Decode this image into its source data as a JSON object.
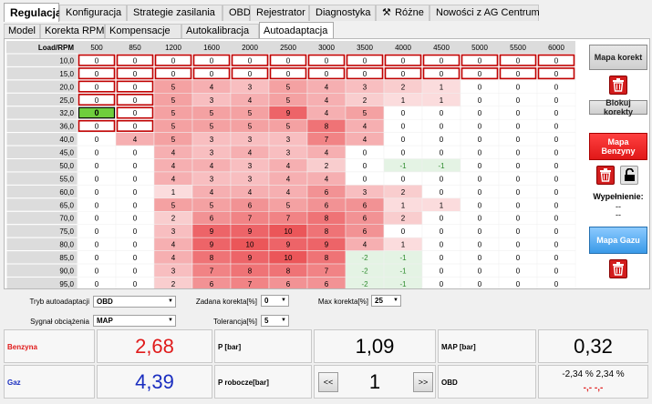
{
  "main_tabs": [
    {
      "label": "Regulacja",
      "active": true
    },
    {
      "label": "Konfiguracja",
      "active": false
    },
    {
      "label": "Strategie zasilania",
      "active": false
    },
    {
      "label": "OBD",
      "active": false
    },
    {
      "label": "Rejestrator",
      "active": false
    },
    {
      "label": "Diagnostyka",
      "active": false
    },
    {
      "label": "Różne",
      "active": false,
      "icon": "tools-icon"
    },
    {
      "label": "Nowości z AG Centrum",
      "active": false
    }
  ],
  "sub_tabs": [
    {
      "label": "Model",
      "active": false
    },
    {
      "label": "Korekta RPM",
      "active": false
    },
    {
      "label": "Kompensacje",
      "active": false
    },
    {
      "label": "Autokalibracja",
      "active": false
    },
    {
      "label": "Autoadaptacja",
      "active": true
    }
  ],
  "grid": {
    "corner_label": "Load/RPM",
    "rpm": [
      "500",
      "850",
      "1200",
      "1600",
      "2000",
      "2500",
      "3000",
      "3500",
      "4000",
      "4500",
      "5000",
      "5500",
      "6000"
    ],
    "loads": [
      "10,0",
      "15,0",
      "20,0",
      "25,0",
      "32,0",
      "36,0",
      "40,0",
      "45,0",
      "50,0",
      "55,0",
      "60,0",
      "65,0",
      "70,0",
      "75,0",
      "80,0",
      "85,0",
      "90,0",
      "95,0"
    ],
    "values": [
      [
        "0",
        "0",
        "0",
        "0",
        "0",
        "0",
        "0",
        "0",
        "0",
        "0",
        "0",
        "0",
        "0"
      ],
      [
        "0",
        "0",
        "0",
        "0",
        "0",
        "0",
        "0",
        "0",
        "0",
        "0",
        "0",
        "0",
        "0"
      ],
      [
        "0",
        "0",
        "5",
        "4",
        "3",
        "5",
        "4",
        "3",
        "2",
        "1",
        "0",
        "0",
        "0"
      ],
      [
        "0",
        "0",
        "5",
        "3",
        "4",
        "5",
        "4",
        "2",
        "1",
        "1",
        "0",
        "0",
        "0"
      ],
      [
        "0",
        "0",
        "5",
        "5",
        "5",
        "9",
        "4",
        "5",
        "0",
        "0",
        "0",
        "0",
        "0"
      ],
      [
        "0",
        "0",
        "5",
        "5",
        "5",
        "5",
        "8",
        "4",
        "0",
        "0",
        "0",
        "0",
        "0"
      ],
      [
        "0",
        "4",
        "5",
        "3",
        "3",
        "3",
        "7",
        "4",
        "0",
        "0",
        "0",
        "0",
        "0"
      ],
      [
        "0",
        "0",
        "4",
        "3",
        "4",
        "3",
        "4",
        "0",
        "0",
        "0",
        "0",
        "0",
        "0"
      ],
      [
        "0",
        "0",
        "4",
        "4",
        "3",
        "4",
        "2",
        "0",
        "-1",
        "-1",
        "0",
        "0",
        "0"
      ],
      [
        "0",
        "0",
        "4",
        "3",
        "3",
        "4",
        "4",
        "0",
        "0",
        "0",
        "0",
        "0",
        "0"
      ],
      [
        "0",
        "0",
        "1",
        "4",
        "4",
        "4",
        "6",
        "3",
        "2",
        "0",
        "0",
        "0",
        "0"
      ],
      [
        "0",
        "0",
        "5",
        "5",
        "6",
        "5",
        "6",
        "6",
        "1",
        "1",
        "0",
        "0",
        "0"
      ],
      [
        "0",
        "0",
        "2",
        "6",
        "7",
        "7",
        "8",
        "6",
        "2",
        "0",
        "0",
        "0",
        "0"
      ],
      [
        "0",
        "0",
        "3",
        "9",
        "9",
        "10",
        "8",
        "6",
        "0",
        "0",
        "0",
        "0",
        "0"
      ],
      [
        "0",
        "0",
        "4",
        "9",
        "10",
        "9",
        "9",
        "4",
        "1",
        "0",
        "0",
        "0",
        "0"
      ],
      [
        "0",
        "0",
        "4",
        "8",
        "9",
        "10",
        "8",
        "-2",
        "-1",
        "0",
        "0",
        "0",
        "0"
      ],
      [
        "0",
        "0",
        "3",
        "7",
        "8",
        "8",
        "7",
        "-2",
        "-1",
        "0",
        "0",
        "0",
        "0"
      ],
      [
        "0",
        "0",
        "2",
        "6",
        "7",
        "6",
        "6",
        "-2",
        "-1",
        "0",
        "0",
        "0",
        "0"
      ]
    ],
    "locked_cells": [
      [
        0,
        0
      ],
      [
        0,
        1
      ],
      [
        0,
        2
      ],
      [
        0,
        3
      ],
      [
        0,
        4
      ],
      [
        0,
        5
      ],
      [
        0,
        6
      ],
      [
        0,
        7
      ],
      [
        0,
        8
      ],
      [
        0,
        9
      ],
      [
        0,
        10
      ],
      [
        0,
        11
      ],
      [
        0,
        12
      ],
      [
        1,
        0
      ],
      [
        1,
        1
      ],
      [
        1,
        2
      ],
      [
        1,
        3
      ],
      [
        1,
        4
      ],
      [
        1,
        5
      ],
      [
        1,
        6
      ],
      [
        1,
        7
      ],
      [
        1,
        8
      ],
      [
        1,
        9
      ],
      [
        1,
        10
      ],
      [
        1,
        11
      ],
      [
        1,
        12
      ],
      [
        2,
        0
      ],
      [
        2,
        1
      ],
      [
        3,
        0
      ],
      [
        3,
        1
      ],
      [
        4,
        1
      ],
      [
        5,
        0
      ],
      [
        5,
        1
      ]
    ],
    "active_cell": [
      4,
      0
    ],
    "colors": {
      "positive": "#e8383c",
      "negative": "#4cae4c",
      "negative_text": "#2e8b2e",
      "locked_border": "#c00000",
      "active_cell": "#6fce3c",
      "header": "#dcdcdc"
    }
  },
  "sidebar": {
    "map_korekt_label": "Mapa korekt",
    "blokuj_label": "Blokuj korekty",
    "mapa_benzyny_label": "Mapa Benzyny",
    "wypelnienie_label": "Wypełnienie:",
    "wypelnienie_value1": "--",
    "wypelnienie_value2": "--",
    "mapa_gazu_label": "Mapa Gazu"
  },
  "controls": {
    "tryb_label": "Tryb autoadaptacji",
    "tryb_value": "OBD",
    "sygnal_label": "Sygnał obciążenia",
    "sygnal_value": "MAP",
    "zadana_label": "Zadana korekta[%]",
    "zadana_value": "0",
    "tolerancja_label": "Tolerancja[%]",
    "tolerancja_value": "5",
    "max_label": "Max korekta[%]",
    "max_value": "25"
  },
  "readouts": {
    "benzyna_label": "Benzyna",
    "benzyna_value": "2,68",
    "gaz_label": "Gaz",
    "gaz_value": "4,39",
    "p_label": "P [bar]",
    "p_value": "1,09",
    "p_robocze_label": "P robocze[bar]",
    "p_robocze_value": "1",
    "prev_label": "<<",
    "next_label": ">>",
    "map_label": "MAP [bar]",
    "map_value": "0,32",
    "obd_label": "OBD",
    "obd_value": "-2,34 % 2,34 %",
    "obd_sub": "-,- -,-",
    "benzyna_color": "#e01b1b",
    "gaz_color": "#1a2ec0",
    "obd_sub_color": "#e01b1b"
  }
}
